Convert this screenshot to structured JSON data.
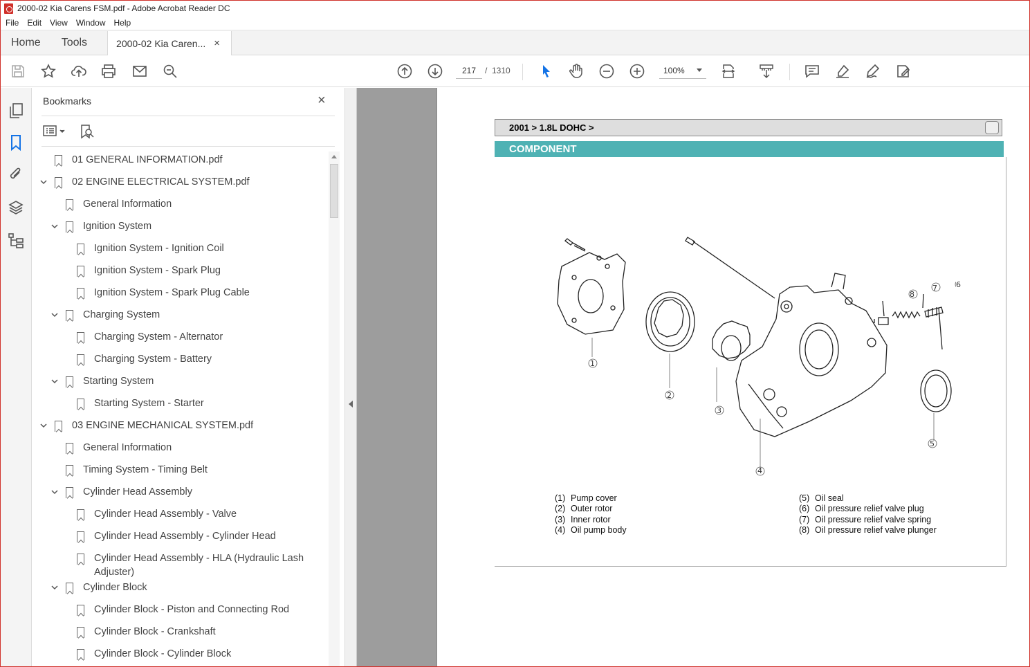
{
  "window": {
    "title": "2000-02 Kia Carens FSM.pdf - Adobe Acrobat Reader DC"
  },
  "menu": [
    "File",
    "Edit",
    "View",
    "Window",
    "Help"
  ],
  "tabs": {
    "home": "Home",
    "tools": "Tools",
    "doc": "2000-02 Kia Caren...",
    "doc_close": "×"
  },
  "toolbar": {
    "page_current": "217",
    "page_sep": "/",
    "page_total": "1310",
    "zoom": "100%",
    "icons": [
      "save-icon",
      "star-icon",
      "upload-icon",
      "print-icon",
      "mail-icon",
      "search-icon",
      "prev-page-icon",
      "next-page-icon",
      "select-arrow-icon",
      "hand-icon",
      "zoom-out-icon",
      "zoom-in-icon",
      "fit-page-icon",
      "scroll-mode-icon",
      "comment-icon",
      "highlight-icon",
      "sign-icon",
      "edit-pdf-icon"
    ]
  },
  "leftrail": {
    "icons": [
      "pages-icon",
      "bookmark-icon",
      "attachment-icon",
      "layers-icon",
      "structure-icon"
    ]
  },
  "bookmarks": {
    "title": "Bookmarks",
    "close": "×",
    "items": [
      {
        "label": "01 GENERAL INFORMATION.pdf",
        "level": 0,
        "expand": "none"
      },
      {
        "label": "02 ENGINE ELECTRICAL SYSTEM.pdf",
        "level": 0,
        "expand": "open"
      },
      {
        "label": "General Information",
        "level": 1,
        "expand": "none"
      },
      {
        "label": "Ignition System",
        "level": 1,
        "expand": "open"
      },
      {
        "label": "Ignition System - Ignition Coil",
        "level": 2,
        "expand": "none"
      },
      {
        "label": "Ignition System - Spark Plug",
        "level": 2,
        "expand": "none"
      },
      {
        "label": "Ignition System - Spark Plug Cable",
        "level": 2,
        "expand": "none"
      },
      {
        "label": "Charging System",
        "level": 1,
        "expand": "open"
      },
      {
        "label": "Charging System - Alternator",
        "level": 2,
        "expand": "none"
      },
      {
        "label": "Charging System - Battery",
        "level": 2,
        "expand": "none"
      },
      {
        "label": "Starting System",
        "level": 1,
        "expand": "open"
      },
      {
        "label": "Starting System - Starter",
        "level": 2,
        "expand": "none"
      },
      {
        "label": "03 ENGINE MECHANICAL SYSTEM.pdf",
        "level": 0,
        "expand": "open"
      },
      {
        "label": "General Information",
        "level": 1,
        "expand": "none"
      },
      {
        "label": "Timing System - Timing Belt",
        "level": 1,
        "expand": "none"
      },
      {
        "label": "Cylinder Head Assembly",
        "level": 1,
        "expand": "open"
      },
      {
        "label": "Cylinder Head Assembly - Valve",
        "level": 2,
        "expand": "none"
      },
      {
        "label": "Cylinder Head Assembly - Cylinder Head",
        "level": 2,
        "expand": "none"
      },
      {
        "label": "Cylinder Head Assembly - HLA (Hydraulic Lash Adjuster)",
        "level": 2,
        "expand": "none"
      },
      {
        "label": "Cylinder Block",
        "level": 1,
        "expand": "open"
      },
      {
        "label": "Cylinder Block - Piston and Connecting Rod",
        "level": 2,
        "expand": "none"
      },
      {
        "label": "Cylinder Block - Crankshaft",
        "level": 2,
        "expand": "none"
      },
      {
        "label": "Cylinder Block - Cylinder Block",
        "level": 2,
        "expand": "none"
      }
    ]
  },
  "document": {
    "breadcrumb": "2001 > 1.8L DOHC >",
    "section": "COMPONENT",
    "section_color": "#4fb2b4",
    "figure_numbers": [
      "1",
      "2",
      "3",
      "4",
      "5",
      "6",
      "7",
      "8"
    ],
    "legend_left": [
      {
        "num": "(1)",
        "text": "Pump cover"
      },
      {
        "num": "(2)",
        "text": "Outer rotor"
      },
      {
        "num": "(3)",
        "text": "Inner rotor"
      },
      {
        "num": "(4)",
        "text": "Oil pump body"
      }
    ],
    "legend_right": [
      {
        "num": "(5)",
        "text": "Oil seal"
      },
      {
        "num": "(6)",
        "text": "Oil pressure relief valve plug"
      },
      {
        "num": "(7)",
        "text": "Oil pressure relief valve spring"
      },
      {
        "num": "(8)",
        "text": "Oil pressure relief valve plunger"
      }
    ]
  }
}
